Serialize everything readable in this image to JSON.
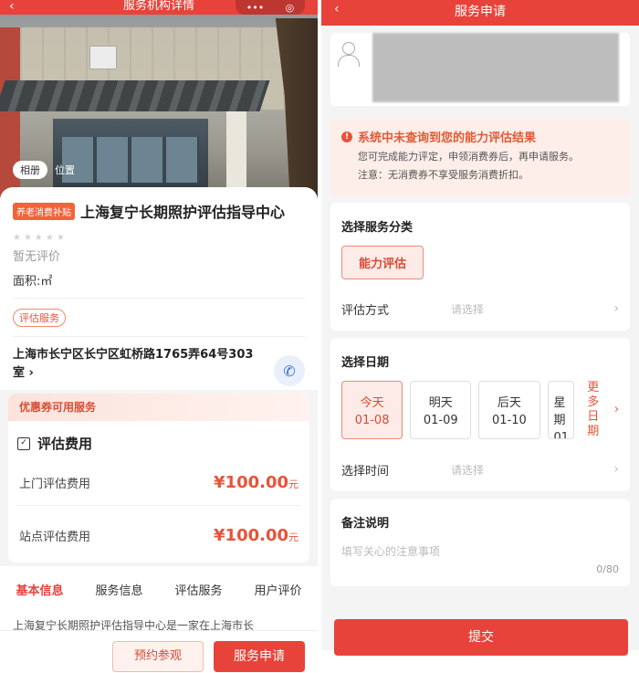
{
  "left": {
    "nav_title": "服务机构详情",
    "back_glyph": "‹",
    "capsule_more": "•••",
    "capsule_close": "◎",
    "photo_tabs": [
      "相册",
      "位置"
    ],
    "subsidy_tag": "养老消费补贴",
    "org_name": "上海复宁长期照护评估指导中心",
    "stars": "★★★★★",
    "rating_text": "暂无评价",
    "area_text": "面积:㎡",
    "service_tag": "评估服务",
    "address": "上海市长宁区长宁区虹桥路1765弄64号303室",
    "address_chevron": "›",
    "coupon_header": "优惠券可用服务",
    "fee_title": "评估费用",
    "fees": [
      {
        "label": "上门评估费用",
        "amount": "¥100.00",
        "unit": "元"
      },
      {
        "label": "站点评估费用",
        "amount": "¥100.00",
        "unit": "元"
      }
    ],
    "tabs": [
      "基本信息",
      "服务信息",
      "评估服务",
      "用户评价"
    ],
    "description": "上海复宁长期照护评估指导中心是一家在上海市长",
    "book_button": "预约参观",
    "apply_button": "服务申请"
  },
  "right": {
    "nav_title": "服务申请",
    "back_glyph": "‹",
    "warning_title": "系统中未查询到您的能力评估结果",
    "warning_line1": "您可完成能力评定，申领消费券后，再申请服务。",
    "warning_line2": "注意：无消费券不享受服务消费折扣。",
    "category_title": "选择服务分类",
    "category_selected": "能力评估",
    "method_label": "评估方式",
    "method_placeholder": "请选择",
    "date_title": "选择日期",
    "dates": [
      {
        "name": "今天",
        "date": "01-08"
      },
      {
        "name": "明天",
        "date": "01-09"
      },
      {
        "name": "后天",
        "date": "01-10"
      },
      {
        "name": "星期",
        "date": "01"
      }
    ],
    "more_dates_line1": "更多",
    "more_dates_line2": "日期",
    "time_label": "选择时间",
    "time_placeholder": "请选择",
    "note_title": "备注说明",
    "note_placeholder": "填写关心的注意事项",
    "note_counter": "0/80",
    "submit_button": "提交",
    "chevron": "›"
  },
  "colors": {
    "brand_red": "#e8433b",
    "price_orange": "#e8533a",
    "warn_bg": "#fdeee9"
  }
}
